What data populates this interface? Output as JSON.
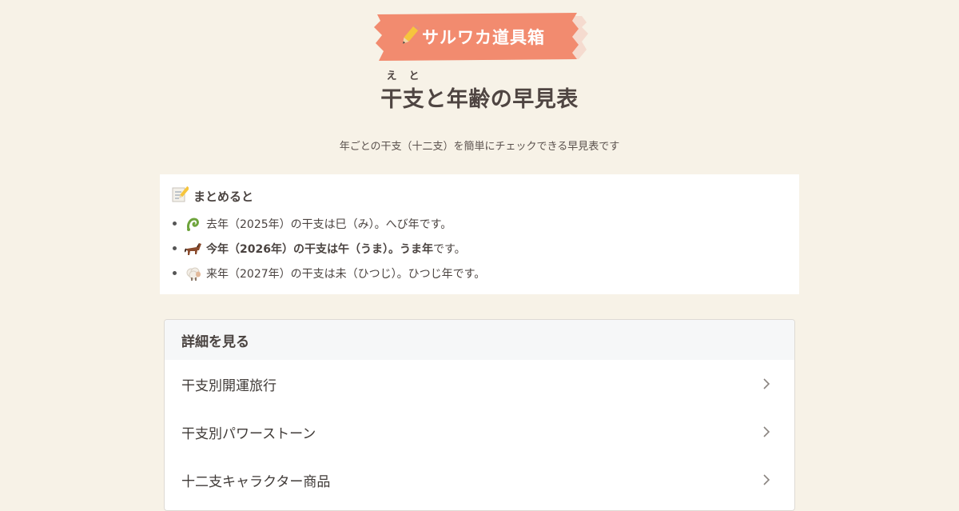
{
  "logo": {
    "text": "サルワカ道具箱",
    "icon": "pencil-icon",
    "ribbon_color": "#f28b6f"
  },
  "header": {
    "title": "干支と年齢の早見表",
    "ruby": [
      "え",
      "と"
    ],
    "subtitle": "年ごとの干支（十二支）を簡単にチェックできる早見表です"
  },
  "summary": {
    "heading_icon": "memo-icon",
    "heading": "まとめると",
    "items": [
      {
        "icon": "snake-icon",
        "text": "去年（2025年）の干支は巳（み）。へび年です。"
      },
      {
        "icon": "horse-icon",
        "text_bold": "今年（2026年）の干支は午（うま）。うま年",
        "text_rest": "です。"
      },
      {
        "icon": "sheep-icon",
        "text": "来年（2027年）の干支は未（ひつじ）。ひつじ年です。"
      }
    ]
  },
  "details": {
    "heading": "詳細を見る",
    "items": [
      {
        "label": "干支別開運旅行"
      },
      {
        "label": "干支別パワーストーン"
      },
      {
        "label": "十二支キャラクター商品"
      }
    ]
  },
  "colors": {
    "background": "#f7f2e7",
    "text": "#4a4340",
    "accent": "#f28b6f"
  }
}
